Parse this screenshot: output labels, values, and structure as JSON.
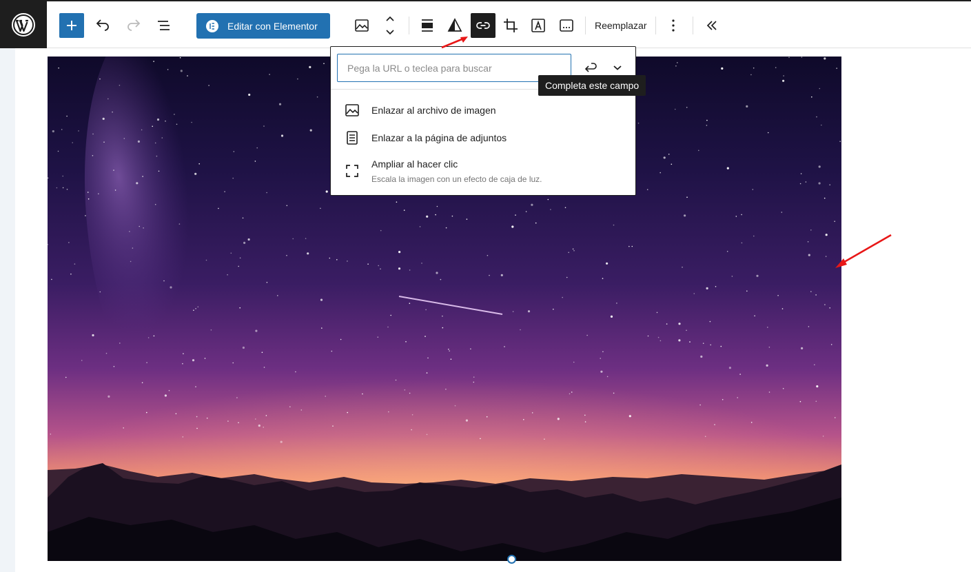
{
  "toolbar": {
    "add_icon": "plus-icon",
    "undo_icon": "undo-icon",
    "redo_icon": "redo-icon",
    "list_view_icon": "list-view-icon",
    "elementor_label": "Editar con Elementor",
    "elementor_icon": "elementor-icon",
    "block_icon": "image-icon",
    "move_icon": "move-up-down-icon",
    "align_icon": "align-icon",
    "duotone_icon": "duotone-icon",
    "link_icon": "link-icon",
    "crop_icon": "crop-icon",
    "text_overlay_icon": "text-overlay-icon",
    "caption_icon": "caption-icon",
    "replace_label": "Reemplazar",
    "options_icon": "more-vertical-icon",
    "collapse_icon": "chevrons-left-icon"
  },
  "link_popover": {
    "url_placeholder": "Pega la URL o teclea para buscar",
    "url_value": "",
    "tooltip": "Completa este campo",
    "items": [
      {
        "label": "Enlazar al archivo de imagen",
        "icon": "image-icon"
      },
      {
        "label": "Enlazar a la página de adjuntos",
        "icon": "page-icon"
      },
      {
        "label": "Ampliar al hacer clic",
        "icon": "fullscreen-icon",
        "description": "Escala la imagen con un efecto de caja de luz."
      }
    ]
  },
  "colors": {
    "accent": "#2271b1",
    "dark": "#1e1e1e",
    "annotation_arrow": "#e81717"
  }
}
